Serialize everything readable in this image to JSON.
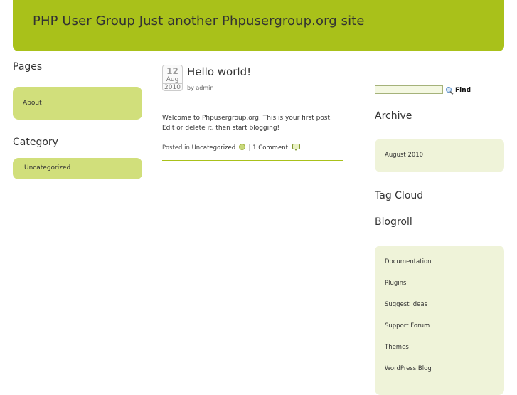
{
  "header": {
    "site_title": "PHP User Group Just another Phpusergroup.org site"
  },
  "left": {
    "pages_title": "Pages",
    "pages": [
      {
        "label": "About"
      }
    ],
    "category_title": "Category",
    "categories": [
      {
        "label": "Uncategorized"
      }
    ]
  },
  "post": {
    "date_day": "12",
    "date_month": "Aug",
    "date_year": "2010",
    "title": "Hello world!",
    "byline_prefix": "by",
    "author": "admin",
    "body_before": "Welcome to ",
    "body_link": "Phpusergroup.org",
    "body_after": ". This is your first post. Edit or delete it, then start blogging!",
    "posted_in_label": "Posted in",
    "category": "Uncategorized",
    "separator": "|",
    "comments": "1 Comment"
  },
  "right": {
    "search_placeholder": "",
    "search_value": "",
    "find_label": "Find",
    "archive_title": "Archive",
    "archives": [
      {
        "label": "August 2010"
      }
    ],
    "tag_cloud_title": "Tag Cloud",
    "blogroll_title": "Blogroll",
    "blogroll": [
      {
        "label": "Documentation"
      },
      {
        "label": "Plugins"
      },
      {
        "label": "Suggest Ideas"
      },
      {
        "label": "Support Forum"
      },
      {
        "label": "Themes"
      },
      {
        "label": "WordPress Blog"
      }
    ]
  },
  "colors": {
    "header_bg": "#a9c11a",
    "sidebar_box_green": "#d1df7b",
    "sidebar_box_pale": "#eff3d9"
  },
  "icons": {
    "search": "magnifier-icon",
    "category": "category-dot-icon",
    "comments": "comment-bubble-icon"
  }
}
